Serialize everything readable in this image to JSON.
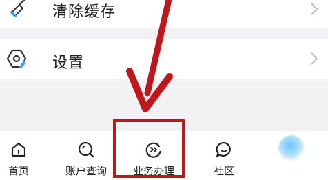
{
  "menu": {
    "items": [
      {
        "label": "清除缓存",
        "icon": "broom-icon"
      },
      {
        "label": "设置",
        "icon": "hexagon-settings-icon"
      }
    ]
  },
  "tabbar": {
    "tabs": [
      {
        "label": "首页",
        "icon": "home-icon"
      },
      {
        "label": "账户查询",
        "icon": "search-icon"
      },
      {
        "label": "业务办理",
        "icon": "business-icon"
      },
      {
        "label": "社区",
        "icon": "chat-bubble-icon"
      }
    ]
  },
  "annotation": {
    "color": "#c0171d"
  },
  "colors": {
    "accent_blue": "#3aa3ff"
  }
}
